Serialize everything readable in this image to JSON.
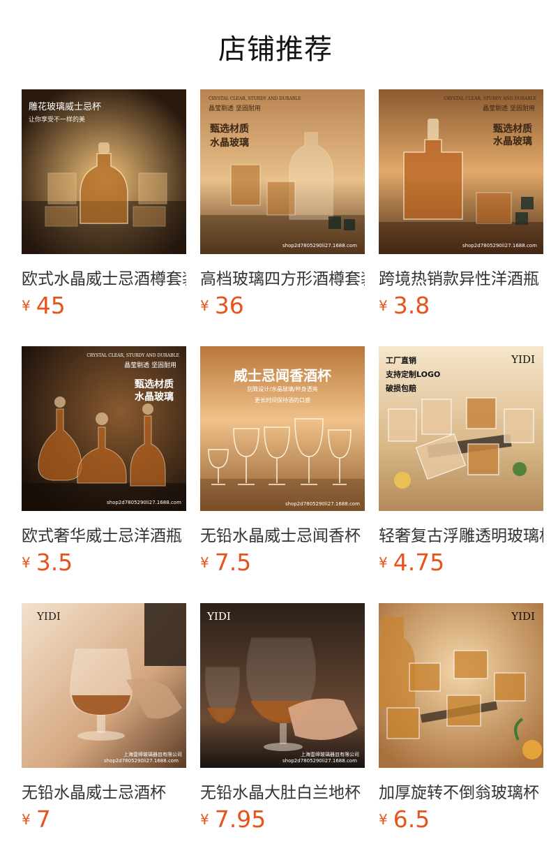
{
  "header": {
    "title": "店铺推荐"
  },
  "products": [
    {
      "name": "欧式水晶威士忌酒樽套装",
      "currency": "¥",
      "price": "45",
      "overlay": [
        "雕花玻璃威士忌杯",
        "让你享受不一样的美"
      ],
      "palette": [
        "#2a1a0e",
        "#c98a43",
        "#3b2414"
      ],
      "image_icon": "decanter-set-icon"
    },
    {
      "name": "高档玻璃四方形酒樽套装",
      "currency": "¥",
      "price": "36",
      "overlay": [
        "CRYSTAL CLEAR, STURDY AND DURABLE",
        "晶莹剔透 坚固耐用",
        "甄选材质",
        "水晶玻璃",
        "shop2d7805290li27.1688.com"
      ],
      "palette": [
        "#5a3a1f",
        "#e3b47c",
        "#6a4524"
      ],
      "image_icon": "decanter-glasses-icon"
    },
    {
      "name": "跨境热销款异性洋酒瓶",
      "currency": "¥",
      "price": "3.8",
      "overlay": [
        "CRYSTAL CLEAR, STURDY AND DURABLE",
        "晶莹剔透 坚固耐用",
        "甄选材质",
        "水晶玻璃",
        "shop2d7805290li27.1688.com"
      ],
      "palette": [
        "#7a4a22",
        "#e2a96a",
        "#4a2d16"
      ],
      "image_icon": "square-decanter-icon"
    },
    {
      "name": "欧式奢华威士忌洋酒瓶",
      "currency": "¥",
      "price": "3.5",
      "overlay": [
        "CRYSTAL CLEAR, STURDY AND DURABLE",
        "晶莹剔透 坚固耐用",
        "甄选材质",
        "水晶玻璃",
        "shop2d7805290li27.1688.com"
      ],
      "palette": [
        "#1e130c",
        "#8a5a30",
        "#241409"
      ],
      "image_icon": "three-decanters-icon"
    },
    {
      "name": "无铅水晶威士忌闻香杯",
      "currency": "¥",
      "price": "7.5",
      "overlay": [
        "威士忌闻香酒杯",
        "别致设计/水晶玻璃/杯身透亮",
        "更长时间保持酒的口感",
        "shop2d7805290li27.1688.com"
      ],
      "palette": [
        "#c9894a",
        "#f0c28a",
        "#8c5a2e"
      ],
      "image_icon": "nosing-glasses-icon"
    },
    {
      "name": "轻奢复古浮雕透明玻璃杯",
      "currency": "¥",
      "price": "4.75",
      "overlay": [
        "工厂直销",
        "支持定制LOGO",
        "破损包赔",
        "YIDI"
      ],
      "palette": [
        "#f3e0c4",
        "#d9b888",
        "#b38a5c"
      ],
      "image_icon": "ribbed-glasses-icon"
    },
    {
      "name": "无铅水晶威士忌酒杯",
      "currency": "¥",
      "price": "7",
      "overlay": [
        "YIDI",
        "上海壹缔玻璃器皿有限公司",
        "shop2d7805290li27.1688.com"
      ],
      "palette": [
        "#efd6bd",
        "#d5a780",
        "#5a3a24"
      ],
      "image_icon": "tulip-glass-icon"
    },
    {
      "name": "无铅水晶大肚白兰地杯",
      "currency": "¥",
      "price": "7.95",
      "overlay": [
        "YIDI",
        "上海壹缔玻璃器皿有限公司",
        "shop2d7805290li27.1688.com"
      ],
      "palette": [
        "#1a1410",
        "#6a4a34",
        "#2c2018"
      ],
      "image_icon": "brandy-snifter-icon"
    },
    {
      "name": "加厚旋转不倒翁玻璃杯",
      "currency": "¥",
      "price": "6.5",
      "overlay": [
        "YIDI"
      ],
      "palette": [
        "#e9bf8a",
        "#f5d7aa",
        "#a8703c"
      ],
      "image_icon": "tumbler-glasses-icon"
    }
  ]
}
